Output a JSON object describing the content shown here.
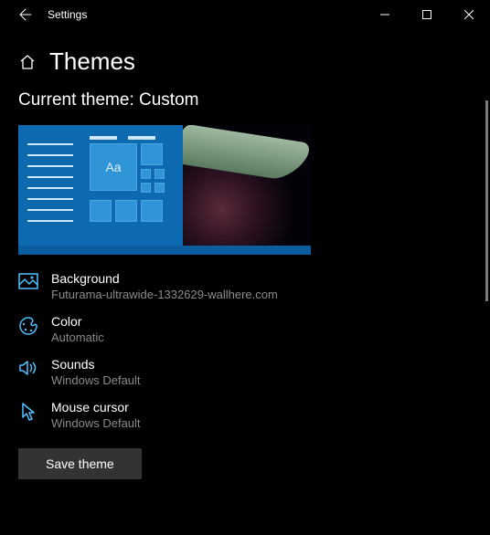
{
  "titlebar": {
    "app_title": "Settings"
  },
  "header": {
    "page_title": "Themes"
  },
  "current_theme": {
    "label": "Current theme: Custom",
    "preview_text": "Aa"
  },
  "items": {
    "background": {
      "label": "Background",
      "value": "Futurama-ultrawide-1332629-wallhere.com"
    },
    "color": {
      "label": "Color",
      "value": "Automatic"
    },
    "sounds": {
      "label": "Sounds",
      "value": "Windows Default"
    },
    "cursor": {
      "label": "Mouse cursor",
      "value": "Windows Default"
    }
  },
  "buttons": {
    "save": "Save theme"
  }
}
